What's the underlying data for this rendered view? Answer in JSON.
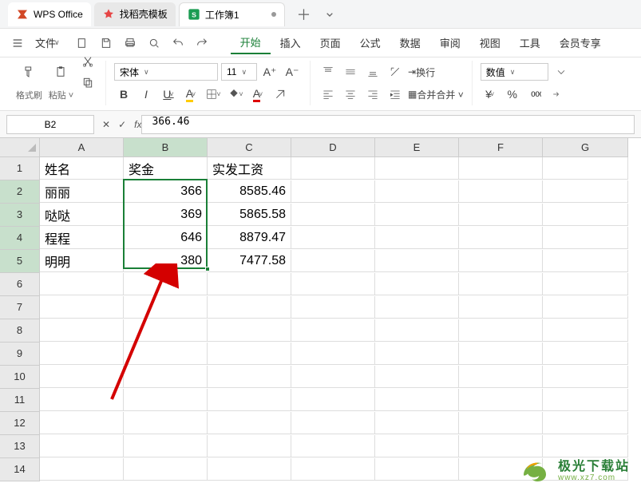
{
  "app_name": "WPS Office",
  "tabs": {
    "template": "找稻壳模板",
    "workbook": "工作簿1"
  },
  "file_menu": "文件",
  "ribbon_tabs": [
    "开始",
    "插入",
    "页面",
    "公式",
    "数据",
    "审阅",
    "视图",
    "工具",
    "会员专享"
  ],
  "ribbon": {
    "format_brush": "格式刷",
    "paste": "粘贴",
    "font_name": "宋体",
    "font_size": "11",
    "wrap_text": "换行",
    "merge_center": "合并",
    "number_format": "数值"
  },
  "namebox": "B2",
  "formula": "366.46",
  "columns": [
    "A",
    "B",
    "C",
    "D",
    "E",
    "F",
    "G"
  ],
  "rows": [
    "1",
    "2",
    "3",
    "4",
    "5",
    "6",
    "7",
    "8",
    "9",
    "10",
    "11",
    "12",
    "13",
    "14"
  ],
  "selected_col_idx": 1,
  "selected_rows": [
    1,
    2,
    3,
    4
  ],
  "chart_data": {
    "type": "table",
    "headers": [
      "姓名",
      "奖金",
      "实发工资"
    ],
    "rows": [
      {
        "name": "丽丽",
        "bonus": 366,
        "salary": 8585.46
      },
      {
        "name": "哒哒",
        "bonus": 369,
        "salary": 5865.58
      },
      {
        "name": "程程",
        "bonus": 646,
        "salary": 8879.47
      },
      {
        "name": "明明",
        "bonus": 380,
        "salary": 7477.58
      }
    ]
  },
  "watermark": {
    "name": "极光下载站",
    "url": "www.xz7.com"
  }
}
